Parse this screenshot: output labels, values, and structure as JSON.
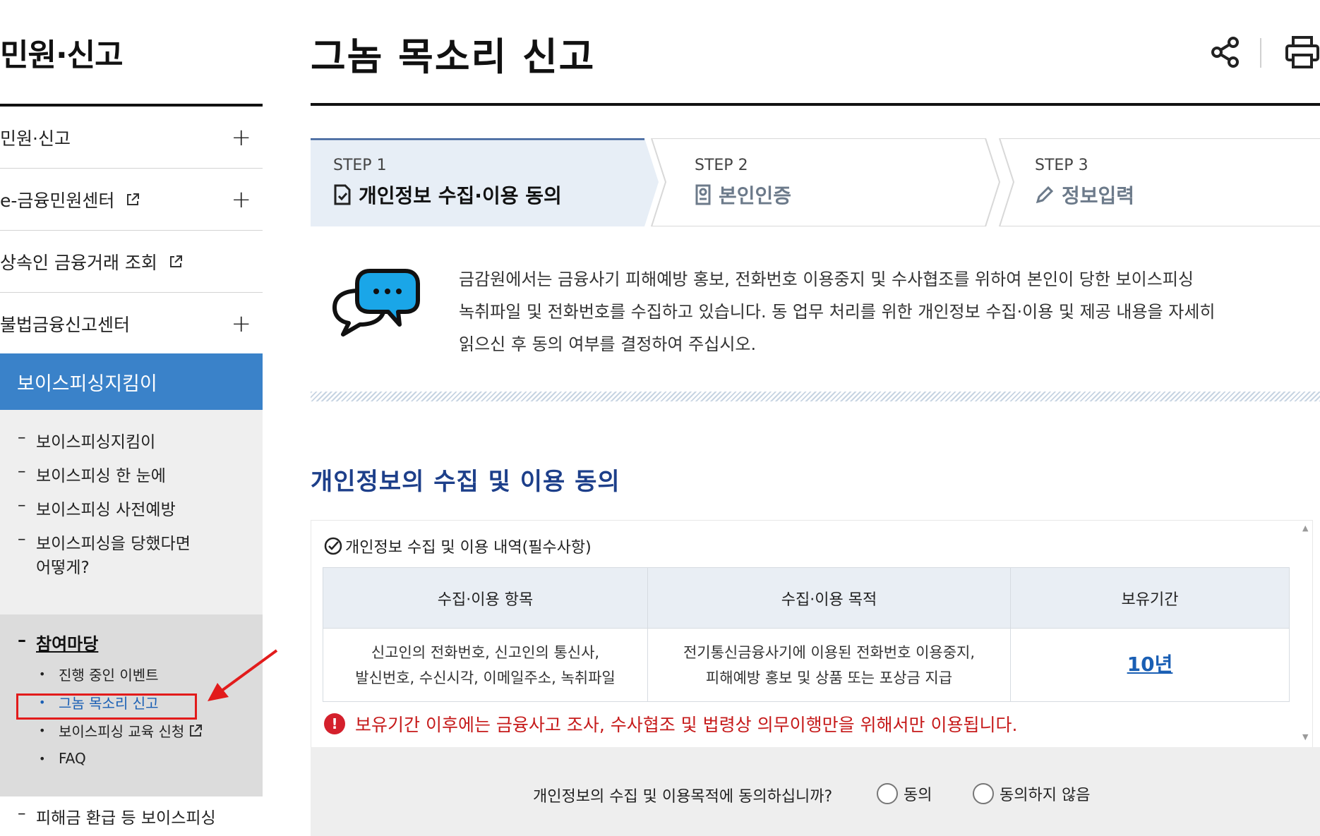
{
  "sidebar": {
    "title": "민원·신고",
    "menu": [
      {
        "label": "민원·신고",
        "expand": "+",
        "external": false
      },
      {
        "label": "e-금융민원센터",
        "expand": "+",
        "external": true
      },
      {
        "label": "상속인 금융거래 조회",
        "expand": "",
        "external": true
      },
      {
        "label": "불법금융신고센터",
        "expand": "+",
        "external": false
      }
    ],
    "active_menu": "보이스피싱지킴이",
    "sub_items": [
      {
        "dash": "–",
        "label": "보이스피싱지킴이"
      },
      {
        "dash": "–",
        "label": "보이스피싱 한 눈에"
      },
      {
        "dash": "–",
        "label": "보이스피싱 사전예방"
      },
      {
        "dash": "–",
        "label": "보이스피싱을 당했다면"
      },
      {
        "dash": "",
        "label": "어떻게?"
      }
    ],
    "participation": {
      "dash": "–",
      "label": "참여마당",
      "items": [
        {
          "bullet": "•",
          "label": "진행 중인 이벤트"
        },
        {
          "bullet": "•",
          "label": "그놈 목소리 신고"
        },
        {
          "bullet": "•",
          "label": "보이스피싱 교육 신청"
        },
        {
          "bullet": "•",
          "label": "FAQ"
        }
      ]
    },
    "bottom_item": {
      "dash": "–",
      "label": "피해금 환급 등 보이스피싱"
    }
  },
  "header": {
    "title": "그놈 목소리 신고",
    "share_icon": "share-icon",
    "print_icon": "print-icon"
  },
  "steps": [
    {
      "step": "STEP 1",
      "label": "개인정보 수집·이용 동의",
      "icon": "document-check-icon",
      "active": true
    },
    {
      "step": "STEP 2",
      "label": "본인인증",
      "icon": "id-card-icon",
      "active": false
    },
    {
      "step": "STEP 3",
      "label": "정보입력",
      "icon": "pencil-icon",
      "active": false
    }
  ],
  "intro": {
    "icon": "chat-bubbles-icon",
    "lines": [
      "금감원에서는 금융사기 피해예방 홍보, 전화번호 이용중지 및 수사협조를 위하여 본인이 당한 보이스피싱",
      "녹취파일 및 전화번호를 수집하고 있습니다. 동 업무 처리를 위한 개인정보 수집·이용 및 제공 내용을 자세히",
      "읽으신 후 동의 여부를 결정하여 주십시오."
    ]
  },
  "consent": {
    "section_title": "개인정보의 수집 및 이용 동의",
    "box_title": "개인정보 수집 및 이용 내역(필수사항)",
    "table": {
      "headers": [
        "수집·이용 항목",
        "수집·이용 목적",
        "보유기간"
      ],
      "row": {
        "items_line1": "신고인의 전화번호, 신고인의 통신사,",
        "items_line2": "발신번호, 수신시각, 이메일주소, 녹취파일",
        "purpose_line1": "전기통신금융사기에 이용된 전화번호 이용중지,",
        "purpose_line2": "피해예방 홍보 및 상품 또는 포상금 지급",
        "retention": "10년"
      }
    },
    "warning": "보유기간 이후에는 금융사고 조사, 수사협조 및 법령상 의무이행만을 위해서만 이용됩니다.",
    "warning_mark": "!",
    "scroll_up": "▲",
    "scroll_down": "▼"
  },
  "agreement": {
    "question": "개인정보의 수집 및 이용목적에 동의하십니까?",
    "options": [
      "동의",
      "동의하지 않음"
    ]
  },
  "colors": {
    "accent": "#3a82c9",
    "section_title": "#1d3f8a",
    "warning": "#c61a1a",
    "selection_box": "#e21b1b",
    "link": "#1a5fb4"
  }
}
